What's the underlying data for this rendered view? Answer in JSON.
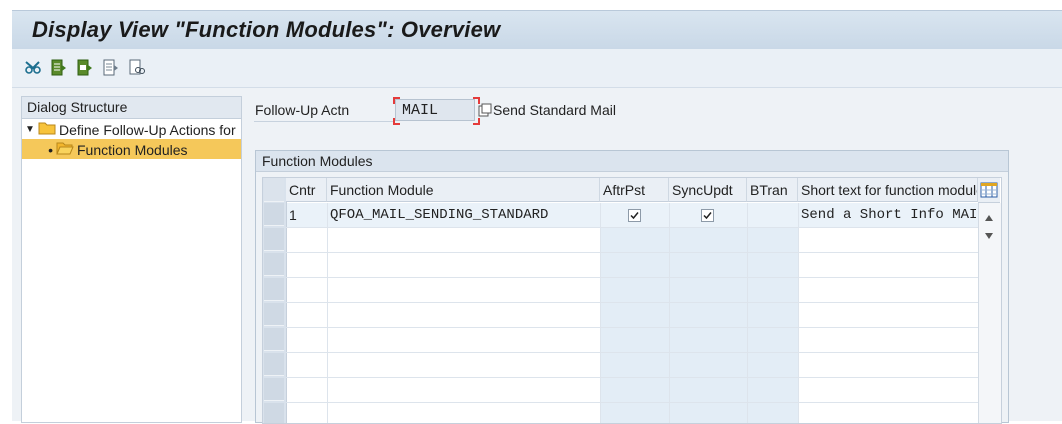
{
  "window": {
    "title": "Display View \"Function Modules\": Overview"
  },
  "toolbar": {
    "buttons": [
      "glasses-icon",
      "select-all-icon",
      "select-block-icon",
      "deselect-all-icon",
      "print-icon"
    ]
  },
  "dialog_structure": {
    "header": "Dialog Structure",
    "items": [
      {
        "label": "Define Follow-Up Actions for",
        "expanded": true,
        "selected": false
      },
      {
        "label": "Function Modules",
        "expanded": false,
        "selected": true
      }
    ]
  },
  "followup": {
    "label": "Follow-Up Actn",
    "value": "MAIL",
    "description": "Send Standard Mail"
  },
  "group": {
    "title": "Function Modules"
  },
  "table": {
    "columns": [
      "Cntr",
      "Function Module",
      "AftrPst",
      "SyncUpdt",
      "BTran",
      "Short text for function module"
    ],
    "rows": [
      {
        "cntr": "1",
        "function_module": "QFOA_MAIL_SENDING_STANDARD",
        "aftrpst": true,
        "syncupdt": true,
        "btran": false,
        "short_text": "Send a Short Info MAIL After"
      }
    ]
  },
  "colors": {
    "title_bar": "#c9d8e7",
    "selected_tree_item": "#f5c85a",
    "focus_marker": "#e43b3b"
  }
}
